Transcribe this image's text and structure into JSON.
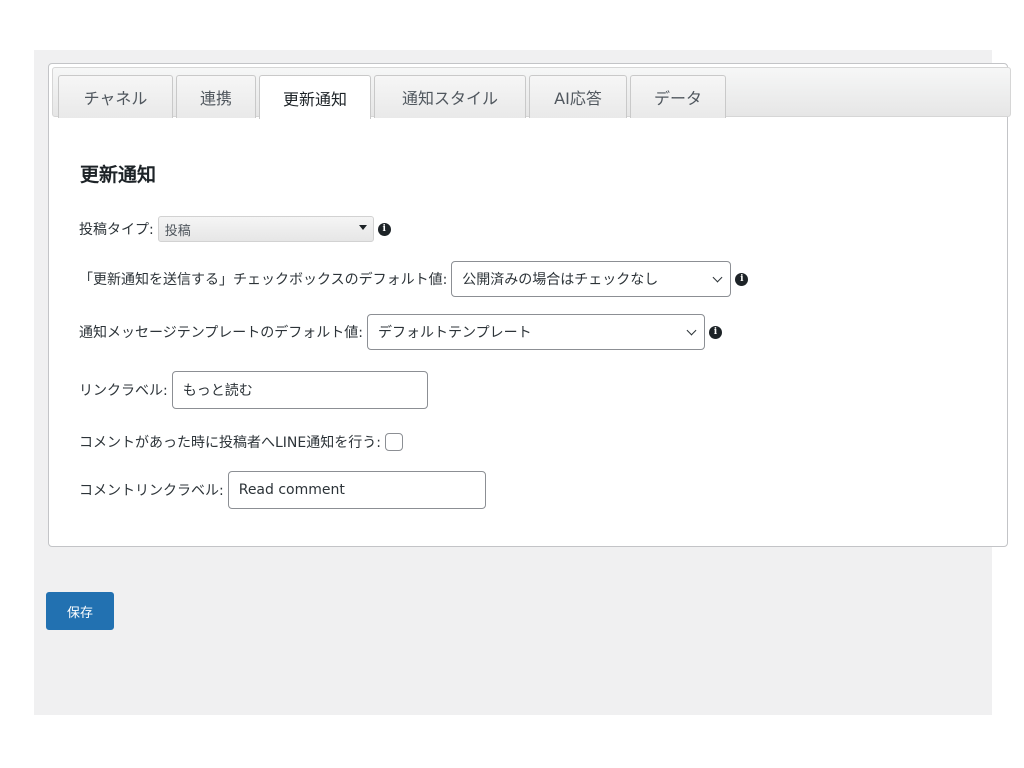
{
  "tabs": [
    {
      "label": "チャネル"
    },
    {
      "label": "連携"
    },
    {
      "label": "更新通知",
      "active": true
    },
    {
      "label": "通知スタイル"
    },
    {
      "label": "AI応答"
    },
    {
      "label": "データ"
    }
  ],
  "section": {
    "title": "更新通知"
  },
  "fields": {
    "post_type": {
      "label": "投稿タイプ:",
      "value": "投稿"
    },
    "default_send": {
      "label": "「更新通知を送信する」チェックボックスのデフォルト値:",
      "value": "公開済みの場合はチェックなし"
    },
    "default_template": {
      "label": "通知メッセージテンプレートのデフォルト値:",
      "value": "デフォルトテンプレート"
    },
    "link_label": {
      "label": "リンクラベル:",
      "value": "もっと読む"
    },
    "comment_notify": {
      "label": "コメントがあった時に投稿者へLINE通知を行う:",
      "checked": false
    },
    "comment_link_label": {
      "label": "コメントリンクラベル:",
      "value": "Read comment"
    }
  },
  "info_icon": "info-icon",
  "save_button": {
    "label": "保存"
  },
  "colors": {
    "primary": "#2271b1",
    "background": "#f0f0f1"
  }
}
